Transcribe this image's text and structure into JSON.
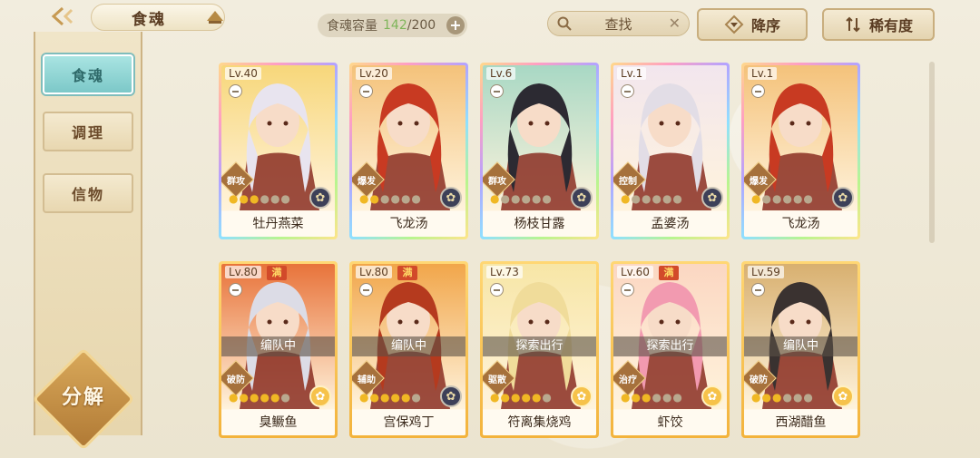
{
  "header": {
    "tab_title": "食魂",
    "capacity_label": "食魂容量",
    "capacity_current": "142",
    "capacity_max": "/200",
    "plus": "+",
    "search_label": "查找",
    "sort_label": "降序",
    "rarity_label": "稀有度"
  },
  "sidebar": {
    "items": [
      {
        "label": "食魂"
      },
      {
        "label": "调理"
      },
      {
        "label": "信物"
      }
    ],
    "decompose_label": "分解"
  },
  "cards": [
    {
      "level": "Lv.40",
      "name": "牡丹燕菜",
      "role": "群攻",
      "stars_on": 3,
      "frame": "rainbow",
      "element": "dark",
      "full": "",
      "status": "",
      "hair": "#e8e4ef",
      "bg": "#f7d77a"
    },
    {
      "level": "Lv.20",
      "name": "飞龙汤",
      "role": "爆发",
      "stars_on": 2,
      "frame": "rainbow",
      "element": "dark",
      "full": "",
      "status": "",
      "hair": "#c83a22",
      "bg": "#f4c27a"
    },
    {
      "level": "Lv.6",
      "name": "杨枝甘露",
      "role": "群攻",
      "stars_on": 1,
      "frame": "rainbow",
      "element": "dark",
      "full": "",
      "status": "",
      "hair": "#2c2a32",
      "bg": "#a8d8c4"
    },
    {
      "level": "Lv.1",
      "name": "孟婆汤",
      "role": "控制",
      "stars_on": 1,
      "frame": "rainbow",
      "element": "dark",
      "full": "",
      "status": "",
      "hair": "#e2dde6",
      "bg": "#f2e6ee"
    },
    {
      "level": "Lv.1",
      "name": "飞龙汤",
      "role": "爆发",
      "stars_on": 1,
      "frame": "rainbow",
      "element": "dark",
      "full": "",
      "status": "",
      "hair": "#c83a22",
      "bg": "#f4c27a"
    },
    {
      "level": "Lv.80",
      "name": "臭鳜鱼",
      "role": "破防",
      "stars_on": 5,
      "frame": "gold",
      "element": "gold",
      "full": "满",
      "status": "编队中",
      "hair": "#dcdce6",
      "bg": "#e8733a"
    },
    {
      "level": "Lv.80",
      "name": "宫保鸡丁",
      "role": "辅助",
      "stars_on": 5,
      "frame": "gold",
      "element": "dark",
      "full": "满",
      "status": "编队中",
      "hair": "#b53a1e",
      "bg": "#f1a64a"
    },
    {
      "level": "Lv.73",
      "name": "符离集烧鸡",
      "role": "驱散",
      "stars_on": 5,
      "frame": "gold",
      "element": "gold",
      "full": "",
      "status": "探索出行",
      "hair": "#f0dc9a",
      "bg": "#f7e6a6"
    },
    {
      "level": "Lv.60",
      "name": "虾饺",
      "role": "治疗",
      "stars_on": 3,
      "frame": "gold",
      "element": "gold",
      "full": "满",
      "status": "探索出行",
      "hair": "#f29ab0",
      "bg": "#fbd7c2"
    },
    {
      "level": "Lv.59",
      "name": "西湖醋鱼",
      "role": "破防",
      "stars_on": 3,
      "frame": "gold",
      "element": "gold",
      "full": "",
      "status": "编队中",
      "hair": "#3a3230",
      "bg": "#d8b070"
    }
  ]
}
